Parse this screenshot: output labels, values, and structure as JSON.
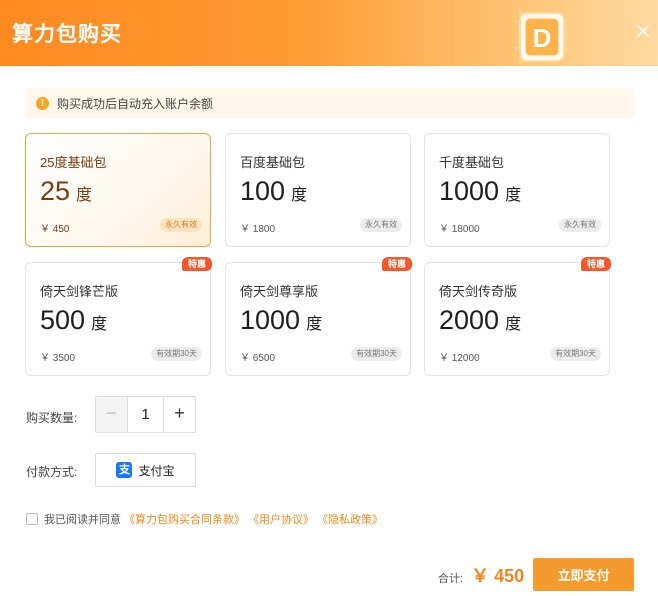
{
  "header": {
    "title": "算力包购买",
    "badge_letter": "D",
    "close_glyph": "×"
  },
  "notice": {
    "icon_glyph": "!",
    "text": "购买成功后自动充入账户余额"
  },
  "packages": [
    {
      "name": "25度基础包",
      "amount": "25",
      "unit": "度",
      "price": "￥ 450",
      "tag": "永久有效",
      "hot": "",
      "selected": true
    },
    {
      "name": "百度基础包",
      "amount": "100",
      "unit": "度",
      "price": "￥ 1800",
      "tag": "永久有效",
      "hot": "",
      "selected": false
    },
    {
      "name": "千度基础包",
      "amount": "1000",
      "unit": "度",
      "price": "￥ 18000",
      "tag": "永久有效",
      "hot": "",
      "selected": false
    },
    {
      "name": "倚天剑锋芒版",
      "amount": "500",
      "unit": "度",
      "price": "￥ 3500",
      "tag": "有效期30天",
      "hot": "特惠",
      "selected": false
    },
    {
      "name": "倚天剑尊享版",
      "amount": "1000",
      "unit": "度",
      "price": "￥ 6500",
      "tag": "有效期30天",
      "hot": "特惠",
      "selected": false
    },
    {
      "name": "倚天剑传奇版",
      "amount": "2000",
      "unit": "度",
      "price": "￥ 12000",
      "tag": "有效期30天",
      "hot": "特惠",
      "selected": false
    }
  ],
  "quantity": {
    "label": "购买数量:",
    "minus": "−",
    "value": "1",
    "plus": "+"
  },
  "payment": {
    "label": "付款方式:",
    "icon_glyph": "支",
    "method": "支付宝"
  },
  "agreement": {
    "prefix": "我已阅读并同意",
    "links": [
      "《算力包购买合同条款》",
      "《用户协议》",
      "《隐私政策》"
    ]
  },
  "footer": {
    "total_label": "合计:",
    "total_value": "￥ 450",
    "submit_label": "立即支付"
  },
  "colors": {
    "accent": "#f59a2c",
    "hot": "#f5572b",
    "link": "#f08a1e"
  }
}
